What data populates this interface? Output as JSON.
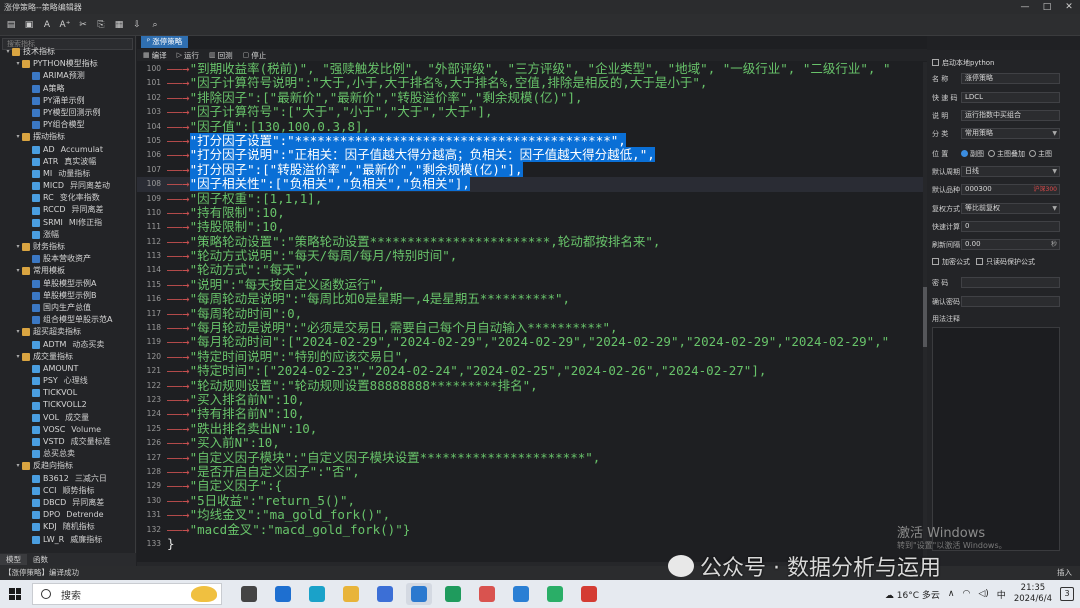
{
  "window": {
    "title": "涨停策略--策略编辑器"
  },
  "toolbar": {
    "icons": [
      "new-file-icon",
      "save-icon",
      "font-decrease-icon",
      "font-increase-icon",
      "cut-icon",
      "copy-icon",
      "paste-icon",
      "import-icon",
      "find-icon"
    ]
  },
  "sidebar": {
    "search_placeholder": "搜索指标",
    "tree": [
      {
        "level": 0,
        "type": "toggle",
        "label": "技术指标"
      },
      {
        "level": 1,
        "type": "folder",
        "label": "PYTHON模型指标"
      },
      {
        "level": 2,
        "type": "py",
        "label": "ARIMA预测"
      },
      {
        "level": 2,
        "type": "py",
        "label": "A策略"
      },
      {
        "level": 2,
        "type": "py",
        "label": "PY涌单示例"
      },
      {
        "level": 2,
        "type": "py",
        "label": "PY模型回测示例"
      },
      {
        "level": 2,
        "type": "py",
        "label": "PY组合模型"
      },
      {
        "level": 1,
        "type": "folder",
        "label": "摆动指标"
      },
      {
        "level": 2,
        "type": "ind",
        "label": "AD",
        "sub": "Accumulat"
      },
      {
        "level": 2,
        "type": "ind",
        "label": "ATR",
        "sub": "真实波幅"
      },
      {
        "level": 2,
        "type": "ind",
        "label": "MI",
        "sub": "动量指标"
      },
      {
        "level": 2,
        "type": "ind",
        "label": "MICD",
        "sub": "异同离差动"
      },
      {
        "level": 2,
        "type": "ind",
        "label": "RC",
        "sub": "变化率指数"
      },
      {
        "level": 2,
        "type": "ind",
        "label": "RCCD",
        "sub": "异同离差"
      },
      {
        "level": 2,
        "type": "ind",
        "label": "SRMI",
        "sub": "MI修正指"
      },
      {
        "level": 2,
        "type": "ind",
        "label": "涨幅"
      },
      {
        "level": 1,
        "type": "folder",
        "label": "财务指标"
      },
      {
        "level": 2,
        "type": "py",
        "label": "股本营收资产"
      },
      {
        "level": 1,
        "type": "folder",
        "label": "常用模板"
      },
      {
        "level": 2,
        "type": "py",
        "label": "单股模型示例A"
      },
      {
        "level": 2,
        "type": "py",
        "label": "单股模型示例B"
      },
      {
        "level": 2,
        "type": "py",
        "label": "国内生产总值"
      },
      {
        "level": 2,
        "type": "py",
        "label": "组合模型单股示范A"
      },
      {
        "level": 1,
        "type": "folder",
        "label": "超买超卖指标"
      },
      {
        "level": 2,
        "type": "ind",
        "label": "ADTM",
        "sub": "动态买卖"
      },
      {
        "level": 1,
        "type": "folder",
        "label": "成交量指标"
      },
      {
        "level": 2,
        "type": "ind",
        "label": "AMOUNT"
      },
      {
        "level": 2,
        "type": "ind",
        "label": "PSY",
        "sub": "心理线"
      },
      {
        "level": 2,
        "type": "ind",
        "label": "TICKVOL"
      },
      {
        "level": 2,
        "type": "ind",
        "label": "TICKVOLL2"
      },
      {
        "level": 2,
        "type": "ind",
        "label": "VOL",
        "sub": "成交量"
      },
      {
        "level": 2,
        "type": "ind",
        "label": "VOSC",
        "sub": "Volume"
      },
      {
        "level": 2,
        "type": "ind",
        "label": "VSTD",
        "sub": "成交量标准"
      },
      {
        "level": 2,
        "type": "ind",
        "label": "总买总卖"
      },
      {
        "level": 1,
        "type": "folder",
        "label": "反趋向指标"
      },
      {
        "level": 2,
        "type": "ind",
        "label": "B3612",
        "sub": "三减六日"
      },
      {
        "level": 2,
        "type": "ind",
        "label": "CCI",
        "sub": "顺势指标"
      },
      {
        "level": 2,
        "type": "ind",
        "label": "DBCD",
        "sub": "异同离差"
      },
      {
        "level": 2,
        "type": "ind",
        "label": "DPO",
        "sub": "Detrende"
      },
      {
        "level": 2,
        "type": "ind",
        "label": "KDJ",
        "sub": "随机指标"
      },
      {
        "level": 2,
        "type": "ind",
        "label": "LW_R",
        "sub": "威廉指标"
      }
    ],
    "bottom_tabs": [
      "模型",
      "函数"
    ]
  },
  "editor": {
    "doc_tab": "涨停策略",
    "actions": [
      "编译",
      "运行",
      "回测",
      "停止"
    ],
    "lines": [
      {
        "n": "100",
        "segs": [
          {
            "t": "\"到期收益率(税前)\", \"强赎触发比例\", \"外部评级\", \"三方评级\", \"企业类型\", \"地域\", \"一级行业\", \"二级行业\", \"",
            "c": "str"
          }
        ]
      },
      {
        "n": "101",
        "segs": [
          {
            "t": "\"因子计算符号说明\":\"大于,小于,大于排名%,大于排名%,空值,排除是相反的,大于是小于\",",
            "c": "str"
          }
        ]
      },
      {
        "n": "102",
        "segs": [
          {
            "t": "\"排除因子\":[\"最新价\",\"最新价\",\"转股溢价率\",\"剩余规模(亿)\"],",
            "c": "str"
          }
        ]
      },
      {
        "n": "103",
        "segs": [
          {
            "t": "\"因子计算符号\":[\"大于\",\"小于\",\"大于\",\"大于\"],",
            "c": "str"
          }
        ]
      },
      {
        "n": "104",
        "segs": [
          {
            "t": "\"因子值\":",
            "c": "str"
          },
          {
            "t": "[130,100,0.3,8],",
            "c": "num"
          }
        ]
      },
      {
        "n": "105",
        "hl": true,
        "segs": [
          {
            "t": "\"打分因子设置\":\"******************************************\",",
            "c": "str"
          }
        ]
      },
      {
        "n": "106",
        "hl": true,
        "segs": [
          {
            "t": "\"打分因子说明\":\"正相关：因子值越大得分越高；负相关：因子值越大得分越低,\",",
            "c": "str"
          }
        ]
      },
      {
        "n": "107",
        "hl": true,
        "segs": [
          {
            "t": "\"打分因子\":[\"转股溢价率\",\"最新价\",\"剩余规模(亿)\"],",
            "c": "str"
          }
        ]
      },
      {
        "n": "108",
        "hl": true,
        "segs": [
          {
            "t": "\"因子相关性\":[\"负相关\",\"负相关\",\"负相关\"],",
            "c": "str"
          }
        ]
      },
      {
        "n": "109",
        "segs": [
          {
            "t": "\"因子权重\":",
            "c": "str"
          },
          {
            "t": "[1,1,1],",
            "c": "num"
          }
        ]
      },
      {
        "n": "110",
        "segs": [
          {
            "t": "\"持有限制\":",
            "c": "str"
          },
          {
            "t": "10,",
            "c": "num"
          }
        ]
      },
      {
        "n": "111",
        "segs": [
          {
            "t": "\"持股限制\":",
            "c": "str"
          },
          {
            "t": "10,",
            "c": "num"
          }
        ]
      },
      {
        "n": "112",
        "segs": [
          {
            "t": "\"策略轮动设置\":\"策略轮动设置************************,轮动都按排名来\",",
            "c": "str"
          }
        ]
      },
      {
        "n": "113",
        "segs": [
          {
            "t": "\"轮动方式说明\":\"每天/每周/每月/特别时间\",",
            "c": "str"
          }
        ]
      },
      {
        "n": "114",
        "segs": [
          {
            "t": "\"轮动方式\":\"每天\",",
            "c": "str"
          }
        ]
      },
      {
        "n": "115",
        "segs": [
          {
            "t": "\"说明\":\"每天按自定义函数运行\",",
            "c": "str"
          }
        ]
      },
      {
        "n": "116",
        "segs": [
          {
            "t": "\"每周轮动是说明\":\"每周比如0是星期一,4是星期五**********\",",
            "c": "str"
          }
        ]
      },
      {
        "n": "117",
        "segs": [
          {
            "t": "\"每周轮动时间\":",
            "c": "str"
          },
          {
            "t": "0,",
            "c": "num"
          }
        ]
      },
      {
        "n": "118",
        "segs": [
          {
            "t": "\"每月轮动是说明\":\"必须是交易日,需要自己每个月自动输入**********\",",
            "c": "str"
          }
        ]
      },
      {
        "n": "119",
        "segs": [
          {
            "t": "\"每月轮动时间\":[\"2024-02-29\",\"2024-02-29\",\"2024-02-29\",\"2024-02-29\",\"2024-02-29\",\"2024-02-29\",\"",
            "c": "str"
          }
        ]
      },
      {
        "n": "120",
        "segs": [
          {
            "t": "\"特定时间说明\":\"特别的应该交易日\",",
            "c": "str"
          }
        ]
      },
      {
        "n": "121",
        "segs": [
          {
            "t": "\"特定时间\":[\"2024-02-23\",\"2024-02-24\",\"2024-02-25\",\"2024-02-26\",\"2024-02-27\"],",
            "c": "str"
          }
        ]
      },
      {
        "n": "122",
        "segs": [
          {
            "t": "\"轮动规则设置\":\"轮动规则设置88888888*********排名\",",
            "c": "str"
          }
        ]
      },
      {
        "n": "123",
        "segs": [
          {
            "t": "\"买入排名前N\":",
            "c": "str"
          },
          {
            "t": "10,",
            "c": "num"
          }
        ]
      },
      {
        "n": "124",
        "segs": [
          {
            "t": "\"持有排名前N\":",
            "c": "str"
          },
          {
            "t": "10,",
            "c": "num"
          }
        ]
      },
      {
        "n": "125",
        "segs": [
          {
            "t": "\"跌出排名卖出N\":",
            "c": "str"
          },
          {
            "t": "10,",
            "c": "num"
          }
        ]
      },
      {
        "n": "126",
        "segs": [
          {
            "t": "\"买入前N\":",
            "c": "str"
          },
          {
            "t": "10,",
            "c": "num"
          }
        ]
      },
      {
        "n": "127",
        "segs": [
          {
            "t": "\"自定义因子模块\":\"自定义因子模块设置**********************\",",
            "c": "str"
          }
        ]
      },
      {
        "n": "128",
        "segs": [
          {
            "t": "\"是否开启自定义因子\":\"否\",",
            "c": "str"
          }
        ]
      },
      {
        "n": "129",
        "segs": [
          {
            "t": "\"自定义因子\":{",
            "c": "str"
          }
        ]
      },
      {
        "n": "130",
        "segs": [
          {
            "t": "\"5日收益\":\"return_5()\",",
            "c": "str"
          }
        ]
      },
      {
        "n": "131",
        "segs": [
          {
            "t": "\"均线金叉\":\"ma_gold_fork()\",",
            "c": "str"
          }
        ]
      },
      {
        "n": "132",
        "segs": [
          {
            "t": "\"macd金叉\":\"macd_gold_fork()\"}",
            "c": "str"
          }
        ]
      },
      {
        "n": "133",
        "noarrow": true,
        "segs": [
          {
            "t": "}",
            "c": "plain"
          }
        ]
      }
    ]
  },
  "props": {
    "enable_python": "启动本地python",
    "name_label": "名    称",
    "name_value": "涨停策略",
    "short_label": "快 速 码",
    "short_value": "LDCL",
    "desc_label": "说    明",
    "desc_value": "运行指数中买组合",
    "cat_label": "分    类",
    "cat_value": "常用策略",
    "pos_label": "位    置",
    "pos_options": [
      "副图",
      "主图叠加",
      "主图"
    ],
    "pos_selected": 0,
    "period_label": "默认周期",
    "period_value": "日线",
    "symbol_label": "默认品种",
    "symbol_value": "000300",
    "symbol_market": "沪深300",
    "adjust_label": "复权方式",
    "adjust_value": "等比前复权",
    "fast_label": "快速计算",
    "fast_value": "0",
    "refresh_label": "刷新间隔",
    "refresh_value": "0.00",
    "refresh_unit": "秒",
    "encrypt_label": "加密公式",
    "readonly_label": "只读码保护公式",
    "pwd_label": "密    码",
    "confirm_label": "确认密码",
    "usage_label": "用法注释"
  },
  "status": {
    "left": "【涨停策略】编译成功",
    "right": "插入"
  },
  "watermarks": {
    "activate": "激活 Windows",
    "activate_sub": "转到\"设置\"以激活 Windows。",
    "wechat": "公众号 · 数据分析与运用"
  },
  "taskbar": {
    "search_text": "搜索",
    "apps": [
      {
        "name": "task-view-icon",
        "color": "#444444"
      },
      {
        "name": "mail-icon",
        "color": "#1e6fd0"
      },
      {
        "name": "edge-icon",
        "color": "#1aa2c9"
      },
      {
        "name": "file-explorer-icon",
        "color": "#e8b43a"
      },
      {
        "name": "store-icon",
        "color": "#3c6fd6"
      },
      {
        "name": "stock-app-icon",
        "color": "#2b79cf",
        "active": true
      },
      {
        "name": "app-green-icon",
        "color": "#1f9b5d"
      },
      {
        "name": "app-terminal-icon",
        "color": "#d9534f"
      },
      {
        "name": "vscode-icon",
        "color": "#2a7fd4"
      },
      {
        "name": "wechat-icon",
        "color": "#2aae67"
      },
      {
        "name": "wps-icon",
        "color": "#d43c33"
      }
    ],
    "weather": "16°C 多云",
    "time": "21:35",
    "date": "2024/6/4",
    "notify_count": "3"
  }
}
